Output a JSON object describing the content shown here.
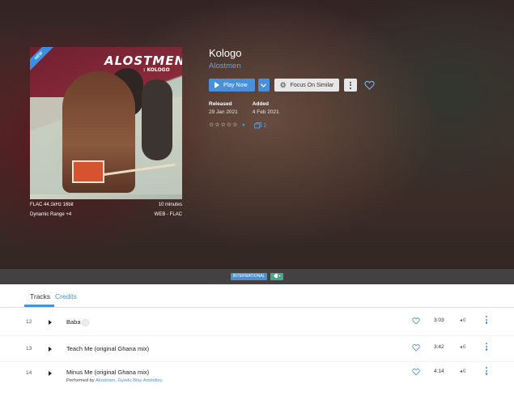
{
  "album": {
    "title": "Kologo",
    "artist": "Alostmen",
    "art_title": "ALOSTMEN",
    "art_subtitle": ": KOLOGO",
    "art_ribbon": "NEW",
    "format": "FLAC 44.1kHz 16bit",
    "duration": "10 minutes",
    "dynamic_range": "Dynamic Range  +4",
    "source": "WEB - FLAC"
  },
  "actions": {
    "play_label": "Play Now",
    "focus_label": "Focus On Similar"
  },
  "dates": {
    "released_label": "Released",
    "released_value": "29 Jan 2021",
    "added_label": "Added",
    "added_value": "4 Feb 2021"
  },
  "rating": {
    "stars": 0,
    "max": 5,
    "versions_count": "2"
  },
  "genres": [
    "INTERNATIONAL"
  ],
  "tabs": [
    {
      "label": "Tracks",
      "active": true
    },
    {
      "label": "Credits",
      "active": false
    }
  ],
  "tracks": [
    {
      "number": "12",
      "title": "Baba",
      "duration": "3:03",
      "vol": "0",
      "performed_by": null
    },
    {
      "number": "13",
      "title": "Teach Me (original Ghana mix)",
      "duration": "3:42",
      "vol": "0",
      "performed_by": null
    },
    {
      "number": "14",
      "title": "Minus Me (original Ghana mix)",
      "duration": "4:14",
      "vol": "0",
      "performed_prefix": "Performed by ",
      "performed_by": "Alostmen",
      "performed_sep": ", ",
      "performed_by_2": "Gyedu Blay Ambolley"
    }
  ],
  "colors": {
    "accent": "#4a90d9",
    "tag_add": "#47a98a"
  }
}
